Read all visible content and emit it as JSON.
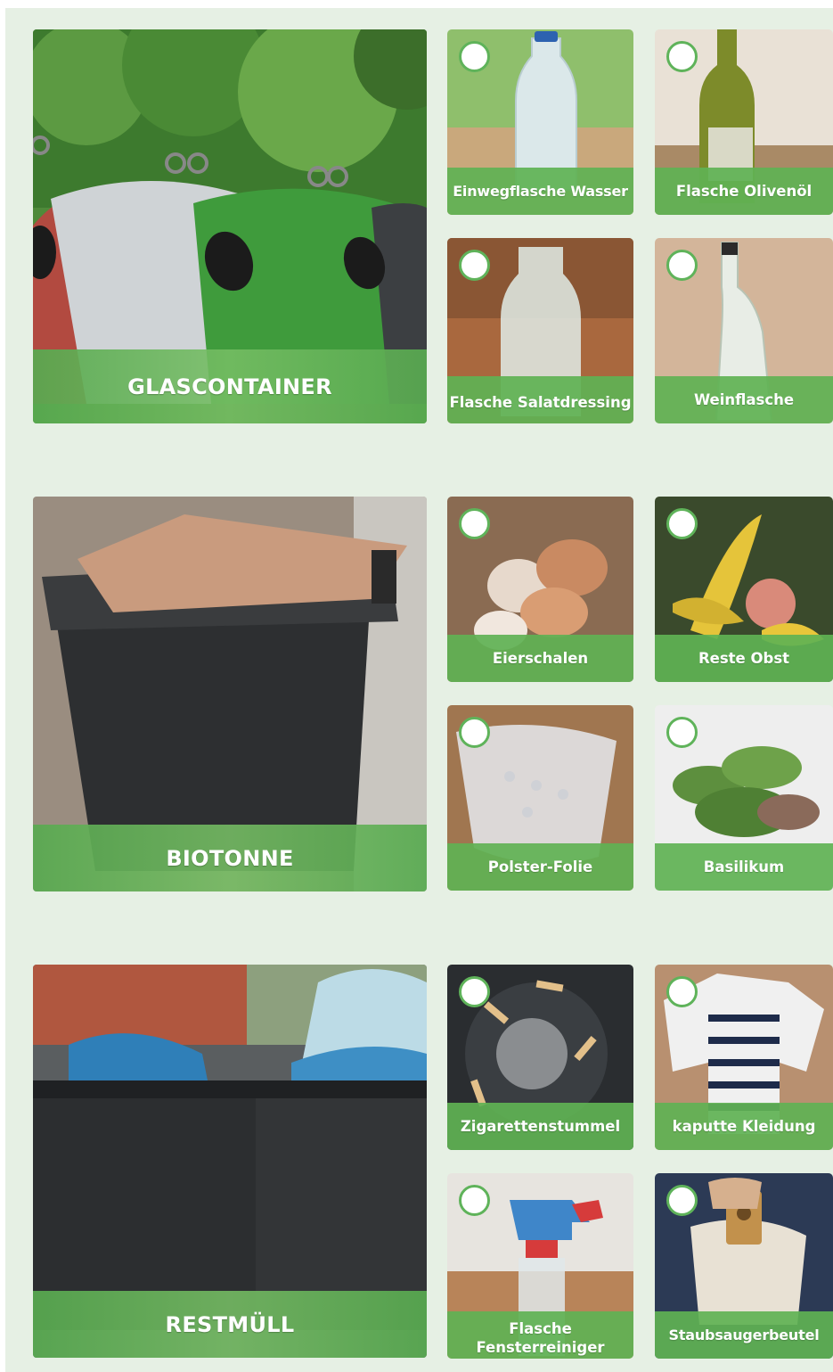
{
  "sections": [
    {
      "title": "GLASCONTAINER",
      "items": [
        {
          "label": "Einwegflasche Wasser"
        },
        {
          "label": "Flasche Olivenöl"
        },
        {
          "label": "Flasche Salatdressing"
        },
        {
          "label": "Weinflasche"
        }
      ]
    },
    {
      "title": "BIOTONNE",
      "items": [
        {
          "label": "Eierschalen"
        },
        {
          "label": "Reste Obst"
        },
        {
          "label": "Polster-Folie"
        },
        {
          "label": "Basilikum"
        }
      ]
    },
    {
      "title": "RESTMÜLL",
      "items": [
        {
          "label": "Zigarettenstummel"
        },
        {
          "label": "kaputte Kleidung"
        },
        {
          "label": "Flasche Fensterreiniger"
        },
        {
          "label": "Staubsaugerbeutel"
        }
      ]
    }
  ],
  "colors": {
    "background": "#e6f0e4",
    "label_green": "#60b254",
    "check_border": "#5fb35a"
  }
}
